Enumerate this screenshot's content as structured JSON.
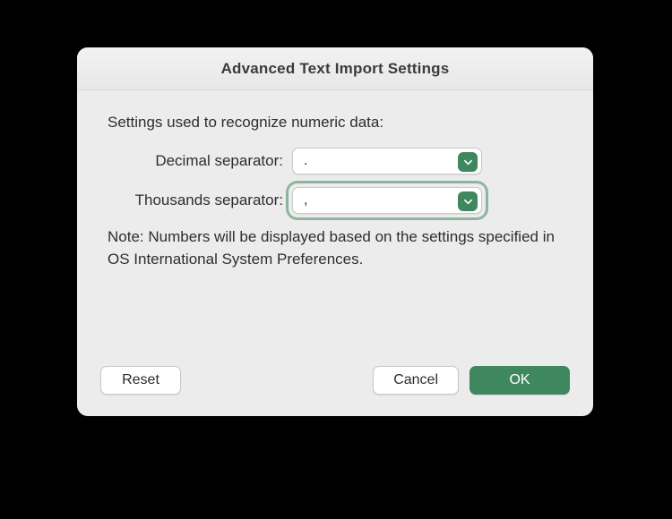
{
  "dialog": {
    "title": "Advanced Text Import Settings",
    "intro": "Settings used to recognize numeric data:",
    "decimal": {
      "label": "Decimal separator:",
      "value": "."
    },
    "thousands": {
      "label": "Thousands separator:",
      "value": ","
    },
    "note": "Note: Numbers will be displayed based on the settings specified in OS International System Preferences.",
    "buttons": {
      "reset": "Reset",
      "cancel": "Cancel",
      "ok": "OK"
    },
    "colors": {
      "accent": "#3f885f"
    }
  }
}
